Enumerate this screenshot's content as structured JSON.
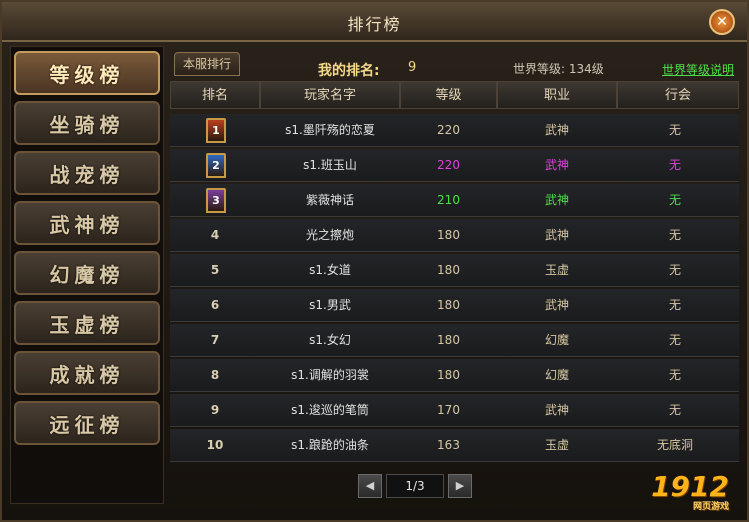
{
  "window": {
    "title": "排行榜",
    "close_label": "✕"
  },
  "sidebar": {
    "items": [
      {
        "label": "等级榜",
        "active": true
      },
      {
        "label": "坐骑榜",
        "active": false
      },
      {
        "label": "战宠榜",
        "active": false
      },
      {
        "label": "武神榜",
        "active": false
      },
      {
        "label": "幻魔榜",
        "active": false
      },
      {
        "label": "玉虚榜",
        "active": false
      },
      {
        "label": "成就榜",
        "active": false
      },
      {
        "label": "远征榜",
        "active": false
      }
    ]
  },
  "main": {
    "tab_label": "本服排行",
    "my_rank_label": "我的排名:",
    "my_rank_value": "9",
    "world_level": "世界等级: 134级",
    "world_level_link": "世界等级说明"
  },
  "table": {
    "headers": [
      "排名",
      "玩家名字",
      "等级",
      "职业",
      "行会"
    ],
    "rows": [
      {
        "rank": "1",
        "name": "s1.墨阡殇的恋夏",
        "level": "220",
        "job": "武神",
        "guild": "无",
        "color": "#d8c7a2",
        "name_color": "#e2e2e2",
        "medal": "#b8401c"
      },
      {
        "rank": "2",
        "name": "s1.班玉山",
        "level": "220",
        "job": "武神",
        "guild": "无",
        "color": "#e040e0",
        "name_color": "#e2e2e2",
        "medal": "#2e6bc4"
      },
      {
        "rank": "3",
        "name": "紫薇神话",
        "level": "210",
        "job": "武神",
        "guild": "无",
        "color": "#4ee04a",
        "name_color": "#e2e2e2",
        "medal": "#7a3e9c"
      },
      {
        "rank": "4",
        "name": "光之擦炮",
        "level": "180",
        "job": "武神",
        "guild": "无",
        "color": "#d8c7a2",
        "name_color": "#e2e2e2",
        "medal": ""
      },
      {
        "rank": "5",
        "name": "s1.女道",
        "level": "180",
        "job": "玉虚",
        "guild": "无",
        "color": "#d8c7a2",
        "name_color": "#e2e2e2",
        "medal": ""
      },
      {
        "rank": "6",
        "name": "s1.男武",
        "level": "180",
        "job": "武神",
        "guild": "无",
        "color": "#d8c7a2",
        "name_color": "#e2e2e2",
        "medal": ""
      },
      {
        "rank": "7",
        "name": "s1.女幻",
        "level": "180",
        "job": "幻魔",
        "guild": "无",
        "color": "#d8c7a2",
        "name_color": "#e2e2e2",
        "medal": ""
      },
      {
        "rank": "8",
        "name": "s1.调解的羽裳",
        "level": "180",
        "job": "幻魔",
        "guild": "无",
        "color": "#d8c7a2",
        "name_color": "#e2e2e2",
        "medal": ""
      },
      {
        "rank": "9",
        "name": "s1.逡巡的笔筒",
        "level": "170",
        "job": "武神",
        "guild": "无",
        "color": "#d8c7a2",
        "name_color": "#e2e2e2",
        "medal": ""
      },
      {
        "rank": "10",
        "name": "s1.踉跄的油条",
        "level": "163",
        "job": "玉虚",
        "guild": "无底洞",
        "color": "#d8c7a2",
        "name_color": "#e2e2e2",
        "medal": ""
      }
    ]
  },
  "pager": {
    "prev_label": "◀",
    "next_label": "▶",
    "page_text": "1/3"
  },
  "logo": {
    "text": "1912",
    "sub": "网页游戏"
  }
}
